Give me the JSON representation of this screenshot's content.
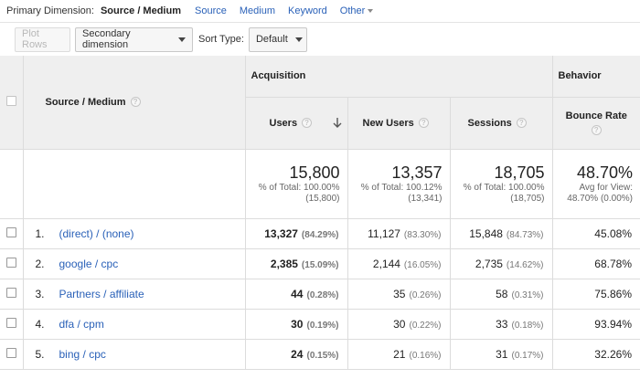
{
  "dimension_bar": {
    "label": "Primary Dimension:",
    "active": "Source / Medium",
    "options": [
      "Source",
      "Medium",
      "Keyword"
    ],
    "other": "Other"
  },
  "toolbar": {
    "plot_rows": "Plot Rows",
    "secondary_dimension": "Secondary dimension",
    "sort_type_label": "Sort Type:",
    "sort_type_value": "Default"
  },
  "table": {
    "group_headers": {
      "acquisition": "Acquisition",
      "behavior": "Behavior"
    },
    "columns": {
      "source_medium": "Source / Medium",
      "users": "Users",
      "new_users": "New Users",
      "sessions": "Sessions",
      "bounce_rate": "Bounce Rate"
    },
    "totals": {
      "users": {
        "value": "15,800",
        "line1": "% of Total: 100.00%",
        "line2": "(15,800)"
      },
      "new_users": {
        "value": "13,357",
        "line1": "% of Total: 100.12%",
        "line2": "(13,341)"
      },
      "sessions": {
        "value": "18,705",
        "line1": "% of Total: 100.00%",
        "line2": "(18,705)"
      },
      "bounce_rate": {
        "value": "48.70%",
        "line1": "Avg for View:",
        "line2": "48.70% (0.00%)"
      }
    },
    "rows": [
      {
        "index": "1.",
        "source": "(direct) / (none)",
        "users": "13,327",
        "users_pct": "(84.29%)",
        "new_users": "11,127",
        "new_users_pct": "(83.30%)",
        "sessions": "15,848",
        "sessions_pct": "(84.73%)",
        "bounce_rate": "45.08%"
      },
      {
        "index": "2.",
        "source": "google / cpc",
        "users": "2,385",
        "users_pct": "(15.09%)",
        "new_users": "2,144",
        "new_users_pct": "(16.05%)",
        "sessions": "2,735",
        "sessions_pct": "(14.62%)",
        "bounce_rate": "68.78%"
      },
      {
        "index": "3.",
        "source": "Partners / affiliate",
        "users": "44",
        "users_pct": "(0.28%)",
        "new_users": "35",
        "new_users_pct": "(0.26%)",
        "sessions": "58",
        "sessions_pct": "(0.31%)",
        "bounce_rate": "75.86%"
      },
      {
        "index": "4.",
        "source": "dfa / cpm",
        "users": "30",
        "users_pct": "(0.19%)",
        "new_users": "30",
        "new_users_pct": "(0.22%)",
        "sessions": "33",
        "sessions_pct": "(0.18%)",
        "bounce_rate": "93.94%"
      },
      {
        "index": "5.",
        "source": "bing / cpc",
        "users": "24",
        "users_pct": "(0.15%)",
        "new_users": "21",
        "new_users_pct": "(0.16%)",
        "sessions": "31",
        "sessions_pct": "(0.17%)",
        "bounce_rate": "32.26%"
      }
    ]
  },
  "icons": {
    "help": "question-mark-icon",
    "sort": "arrow-down-icon",
    "dropdown": "chevron-down-icon"
  },
  "colors": {
    "link": "#2a61b8",
    "header_bg": "#efefef",
    "border": "#dcdcdc"
  }
}
